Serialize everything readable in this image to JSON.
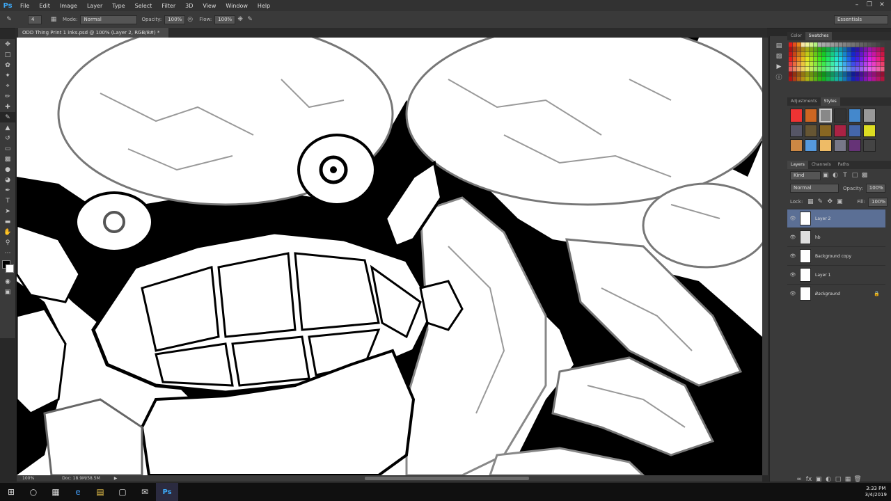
{
  "menu": {
    "logo": "Ps",
    "items": [
      "File",
      "Edit",
      "Image",
      "Layer",
      "Type",
      "Select",
      "Filter",
      "3D",
      "View",
      "Window",
      "Help"
    ]
  },
  "options": {
    "brush_size": "4",
    "mode_label": "Mode:",
    "mode_value": "Normal",
    "opacity_label": "Opacity:",
    "opacity_value": "100%",
    "flow_label": "Flow:",
    "flow_value": "100%",
    "workspace": "Essentials"
  },
  "document": {
    "tab_title": "ODD Thing Print 1 inks.psd @ 100% (Layer 2, RGB/8#) *",
    "zoom": "100%",
    "doc_size": "Doc: 18.9M/58.5M"
  },
  "panels": {
    "color_tabs": [
      "Color",
      "Swatches"
    ],
    "adjust_tabs": [
      "Adjustments",
      "Styles"
    ],
    "layers_tabs": [
      "Layers",
      "Channels",
      "Paths"
    ],
    "kind_label": "Kind",
    "blend_mode": "Normal",
    "opacity_label": "Opacity:",
    "opacity_value": "100%",
    "lock_label": "Lock:",
    "fill_label": "Fill:",
    "fill_value": "100%",
    "layers": [
      {
        "name": "Layer 2"
      },
      {
        "name": "hb"
      },
      {
        "name": "Background copy"
      },
      {
        "name": "Layer 1"
      },
      {
        "name": "Background"
      }
    ]
  },
  "taskbar": {
    "time": "3:33 PM",
    "date": "3/4/2019"
  },
  "colors": {
    "accent": "#3da8f5",
    "selected_layer": "#5b6f95",
    "ui_dark": "#3a3a3a"
  }
}
